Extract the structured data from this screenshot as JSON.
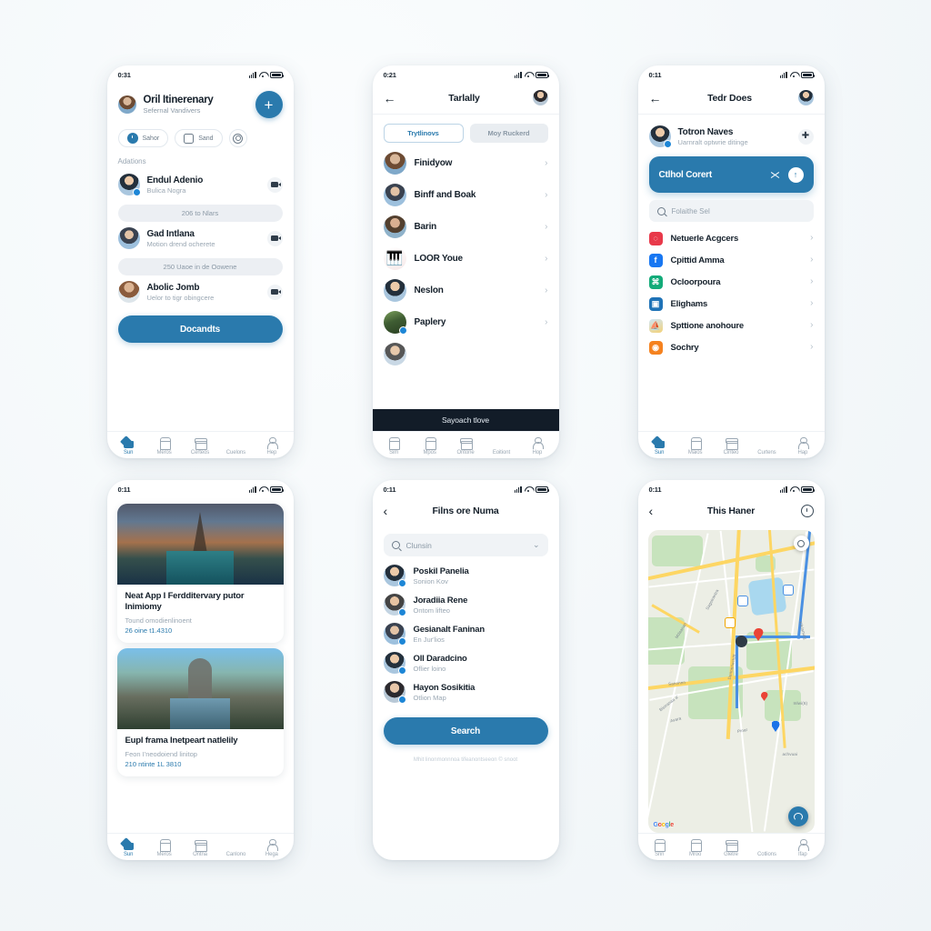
{
  "canvas": {
    "background": "#f6f9fb",
    "accent": "#2a7aad"
  },
  "screens": [
    {
      "id": "itinerary",
      "status": {
        "time": "0:31"
      },
      "header": {
        "title": "Oril Itinerenary",
        "subtitle": "Sefernal Vandivers",
        "fab": "+"
      },
      "chips": [
        {
          "label": "Sahor",
          "icon": "clock-icon"
        },
        {
          "label": "Sand",
          "icon": "card-icon"
        },
        {
          "label": "",
          "icon": "target-icon"
        }
      ],
      "section_label": "Adations",
      "people": [
        {
          "name": "Endul Adenio",
          "subtitle": "Bulica Nogra",
          "action": "video-icon",
          "pill": "206 to Nlars"
        },
        {
          "name": "Gad Intlana",
          "subtitle": "Motion drend ocherete",
          "action": "flag-icon",
          "pill": "250 Uaoe in de Oowene"
        },
        {
          "name": "Abolic Jomb",
          "subtitle": "Uelor to tigr obingcere",
          "action": "chat-icon",
          "pill": ""
        }
      ],
      "cta": "Docandts",
      "tabs": [
        {
          "label": "Sun",
          "icon": "home-icon",
          "active": true
        },
        {
          "label": "Meros",
          "icon": "house-icon",
          "active": false
        },
        {
          "label": "Certeos",
          "icon": "store-icon",
          "active": false
        },
        {
          "label": "Cuelons",
          "icon": "document-icon",
          "active": false
        },
        {
          "label": "Hep",
          "icon": "profile-icon",
          "active": false
        }
      ]
    },
    {
      "id": "tarlally",
      "status": {
        "time": "0:21"
      },
      "header": {
        "back": "←",
        "title": "Tarlally",
        "avatar": "avatar-icon"
      },
      "segments": [
        {
          "label": "Trytlinovs",
          "selected": true
        },
        {
          "label": "Moy Ruckerd",
          "selected": false
        }
      ],
      "rows": [
        {
          "name": "Finidyow"
        },
        {
          "name": "Binff and Boak"
        },
        {
          "name": "Barin"
        },
        {
          "name": "LOOR Youe"
        },
        {
          "name": "Neslon"
        },
        {
          "name": "Paplery"
        }
      ],
      "banner": "Sayoach tlove",
      "tabs": [
        {
          "label": "Sim",
          "icon": "home-icon",
          "active": false
        },
        {
          "label": "Mpos",
          "icon": "house-icon",
          "active": false
        },
        {
          "label": "Ontone",
          "icon": "store-icon",
          "active": false
        },
        {
          "label": "Eoitiont",
          "icon": "document-icon",
          "active": false
        },
        {
          "label": "Hop",
          "icon": "profile-icon",
          "active": false
        }
      ]
    },
    {
      "id": "tedr-does",
      "status": {
        "time": "0:11"
      },
      "header": {
        "back": "←",
        "title": "Tedr Does",
        "avatar": "avatar-icon"
      },
      "profile": {
        "name": "Totron Naves",
        "subtitle": "Uarnralt optwrie ditinge",
        "action": "plus-icon"
      },
      "action_card": {
        "label": "Ctlhol Corert",
        "share": "share-icon",
        "go": "arrow-up-icon"
      },
      "search": {
        "placeholder": "Folaithe Sel",
        "icon": "search-icon"
      },
      "apps": [
        {
          "name": "Netuerle Acgcers",
          "color": "#e8394a",
          "glyph": "◔"
        },
        {
          "name": "Cpittid Amma",
          "color": "#1877f2",
          "glyph": "f"
        },
        {
          "name": "Ocloorpoura",
          "color": "#13ab79",
          "glyph": "⌘"
        },
        {
          "name": "Elighams",
          "color": "#1f73b7",
          "glyph": "▣"
        },
        {
          "name": "Spttione anohoure",
          "color": "#f0c24b",
          "glyph": "⛵"
        },
        {
          "name": "Sochry",
          "color": "#f5821f",
          "glyph": "◉"
        }
      ],
      "tabs": [
        {
          "label": "Sun",
          "icon": "home-icon",
          "active": true
        },
        {
          "label": "Maios",
          "icon": "house-icon",
          "active": false
        },
        {
          "label": "Cinteo",
          "icon": "store-icon",
          "active": false
        },
        {
          "label": "Curtens",
          "icon": "document-icon",
          "active": false
        },
        {
          "label": "Hap",
          "icon": "profile-icon",
          "active": false
        }
      ]
    },
    {
      "id": "feed",
      "status": {
        "time": "0:11"
      },
      "cards": [
        {
          "image": "eiffel-tower-photo",
          "title": "Neat App I Ferdditervary putor Inimiomy",
          "subtitle": "Tound omodienlinoent",
          "meta": "26 oine t1.4310"
        },
        {
          "image": "arch-avenue-photo",
          "title": "Eupl frama Inetpeart natlelily",
          "subtitle": "Feon I'neodoiend linitop",
          "meta": "210 ntinte 1L 3810"
        }
      ],
      "tabs": [
        {
          "label": "Sun",
          "icon": "home-icon",
          "active": true
        },
        {
          "label": "Meros",
          "icon": "house-icon",
          "active": false
        },
        {
          "label": "Ontna",
          "icon": "store-icon",
          "active": false
        },
        {
          "label": "Canlono",
          "icon": "document-icon",
          "active": false
        },
        {
          "label": "Hega",
          "icon": "profile-icon",
          "active": false
        }
      ]
    },
    {
      "id": "filter-search",
      "status": {
        "time": "0:11"
      },
      "header": {
        "back": "‹",
        "title": "Filns ore Numa"
      },
      "search": {
        "value": "Clunsin",
        "icon": "search-icon",
        "caret": "chevron-down-icon"
      },
      "people": [
        {
          "name": "Poskil Panelia",
          "subtitle": "Sonion Kov"
        },
        {
          "name": "Joradiia Rene",
          "subtitle": "Ontom lifteo"
        },
        {
          "name": "Gesianalt Faninan",
          "subtitle": "En Jur'lios"
        },
        {
          "name": "Oll Daradcino",
          "subtitle": "Oflier loino"
        },
        {
          "name": "Hayon Sosikitia",
          "subtitle": "Otlion Map"
        }
      ],
      "cta": "Search",
      "footnote": "Mhit linonmonnnoa tifeanontseeon  © snoot"
    },
    {
      "id": "map",
      "status": {
        "time": "0:11"
      },
      "header": {
        "back": "‹",
        "title": "This Haner",
        "action": "compass-icon"
      },
      "map": {
        "labels": [
          "Sagstrantra",
          "Mdaanan",
          "Kfelsnurg",
          "Dennenachlff",
          "Pinar",
          "achvuai",
          "Inlwi(6)",
          "Avara",
          "Sanonnn",
          "Blstranaa a'"
        ],
        "attribution": "Google",
        "locate_button": "locate-icon",
        "layers_button": "layers-icon"
      },
      "tabs": [
        {
          "label": "Srin",
          "icon": "home-icon",
          "active": false
        },
        {
          "label": "Mroo",
          "icon": "house-icon",
          "active": false
        },
        {
          "label": "Gletre",
          "icon": "store-icon",
          "active": false
        },
        {
          "label": "Cotlions",
          "icon": "document-icon",
          "active": false
        },
        {
          "label": "Ifap",
          "icon": "profile-icon",
          "active": false
        }
      ]
    }
  ]
}
